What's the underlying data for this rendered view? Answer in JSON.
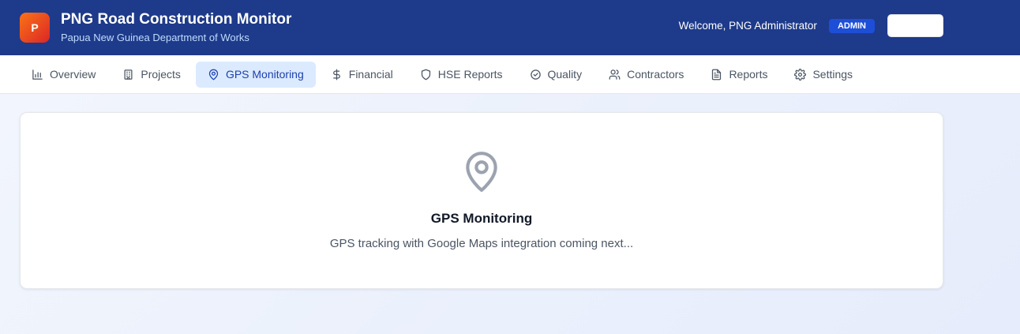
{
  "header": {
    "logo_letter": "P",
    "title": "PNG Road Construction Monitor",
    "subtitle": "Papua New Guinea Department of Works",
    "welcome": "Welcome, PNG Administrator",
    "role_badge": "ADMIN"
  },
  "nav": {
    "tabs": [
      {
        "label": "Overview",
        "icon": "bar-chart-icon"
      },
      {
        "label": "Projects",
        "icon": "building-icon"
      },
      {
        "label": "GPS Monitoring",
        "icon": "map-pin-icon",
        "active": true
      },
      {
        "label": "Financial",
        "icon": "dollar-icon"
      },
      {
        "label": "HSE Reports",
        "icon": "shield-icon"
      },
      {
        "label": "Quality",
        "icon": "check-circle-icon"
      },
      {
        "label": "Contractors",
        "icon": "users-icon"
      },
      {
        "label": "Reports",
        "icon": "file-text-icon"
      },
      {
        "label": "Settings",
        "icon": "gear-icon"
      }
    ]
  },
  "main": {
    "icon": "map-pin-icon",
    "title": "GPS Monitoring",
    "message": "GPS tracking with Google Maps integration coming next..."
  },
  "colors": {
    "header_bg": "#1e3a8a",
    "active_tab_bg": "#dbeafe",
    "active_tab_text": "#1e40af",
    "logo_gradient": [
      "#f97316",
      "#dc2626"
    ]
  }
}
